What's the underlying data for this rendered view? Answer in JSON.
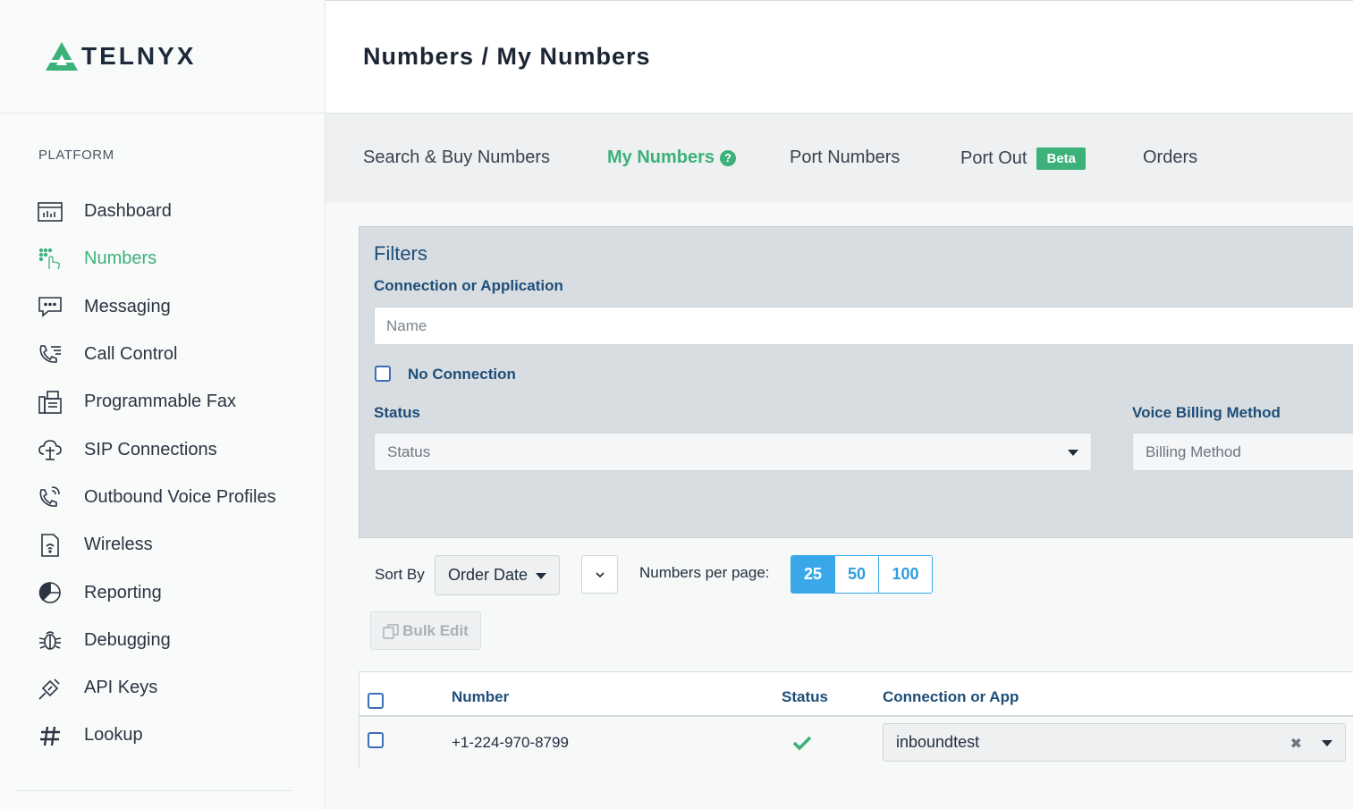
{
  "brand": {
    "name": "TELNYX",
    "accent": "#3cb179"
  },
  "header": {
    "title": "Numbers / My Numbers"
  },
  "sidebar": {
    "section": "PLATFORM",
    "items": [
      {
        "label": "Dashboard",
        "icon": "dashboard-icon"
      },
      {
        "label": "Numbers",
        "icon": "numbers-keypad-icon",
        "active": true
      },
      {
        "label": "Messaging",
        "icon": "chat-bubble-icon"
      },
      {
        "label": "Call Control",
        "icon": "phone-list-icon"
      },
      {
        "label": "Programmable Fax",
        "icon": "fax-icon"
      },
      {
        "label": "SIP Connections",
        "icon": "sip-cloud-icon"
      },
      {
        "label": "Outbound Voice Profiles",
        "icon": "phone-outgoing-icon"
      },
      {
        "label": "Wireless",
        "icon": "sim-card-icon"
      },
      {
        "label": "Reporting",
        "icon": "pie-chart-icon"
      },
      {
        "label": "Debugging",
        "icon": "bug-icon"
      },
      {
        "label": "API Keys",
        "icon": "key-icon"
      },
      {
        "label": "Lookup",
        "icon": "hash-icon"
      }
    ]
  },
  "tabs": [
    {
      "label": "Search & Buy Numbers"
    },
    {
      "label": "My Numbers",
      "active": true
    },
    {
      "label": "Port Numbers"
    },
    {
      "label": "Port Out",
      "badge": "Beta"
    },
    {
      "label": "Orders"
    }
  ],
  "filters": {
    "title": "Filters",
    "connection_label": "Connection or Application",
    "connection_placeholder": "Name",
    "no_connection_label": "No Connection",
    "status_label": "Status",
    "status_placeholder": "Status",
    "billing_label": "Voice Billing Method",
    "billing_placeholder": "Billing Method"
  },
  "sort": {
    "label": "Sort By",
    "value": "Order Date",
    "per_page_label": "Numbers per page:",
    "per_page_options": [
      "25",
      "50",
      "100"
    ],
    "per_page_selected": "25"
  },
  "bulk_edit_label": "Bulk Edit",
  "table": {
    "columns": [
      "Number",
      "Status",
      "Connection or App"
    ],
    "rows": [
      {
        "number": "+1-224-970-8799",
        "status": "active",
        "connection": "inboundtest"
      }
    ]
  }
}
